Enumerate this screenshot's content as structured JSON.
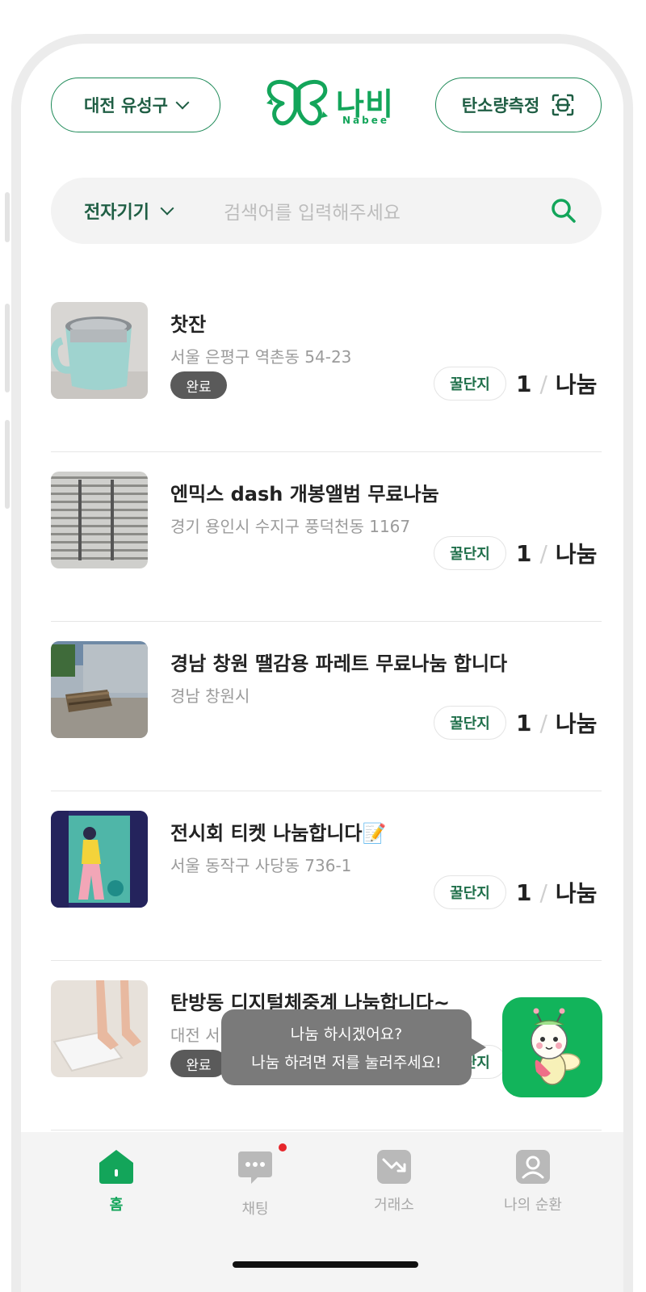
{
  "header": {
    "location": "대전 유성구",
    "logo_text": "나비",
    "logo_sub": "Nabee",
    "carbon_button": "탄소량측정"
  },
  "search": {
    "category": "전자기기",
    "placeholder": "검색어를 입력해주세요"
  },
  "items": [
    {
      "title": "찻잔",
      "address": "서울 은평구 역촌동 54-23",
      "status": "완료",
      "tag": "꿀단지",
      "count": "1",
      "type": "나눔"
    },
    {
      "title": "엔믹스 dash 개봉앨범 무료나눔",
      "address": "경기 용인시 수지구 풍덕천동 1167",
      "status": "",
      "tag": "꿀단지",
      "count": "1",
      "type": "나눔"
    },
    {
      "title": "경남 창원 땔감용 파레트 무료나눔 합니다",
      "address": "경남 창원시",
      "status": "",
      "tag": "꿀단지",
      "count": "1",
      "type": "나눔"
    },
    {
      "title": "전시회 티켓 나눔합니다📝",
      "address": "서울 동작구 사당동 736-1",
      "status": "",
      "tag": "꿀단지",
      "count": "1",
      "type": "나눔"
    },
    {
      "title": "탄방동 디지털체중계 나눔합니다~",
      "address": "대전 서",
      "status": "완료",
      "tag": "꿀단지",
      "count": "",
      "type": ""
    }
  ],
  "tooltip": {
    "line1": "나눔 하시겠어요?",
    "line2": "나눔 하려면 저를 눌러주세요!"
  },
  "nav": {
    "home": "홈",
    "chat": "채팅",
    "exchange": "거래소",
    "my": "나의 순환"
  },
  "colors": {
    "brand": "#13a55a",
    "brand_dark": "#1f5e44",
    "chat_badge": "#e6262b"
  }
}
